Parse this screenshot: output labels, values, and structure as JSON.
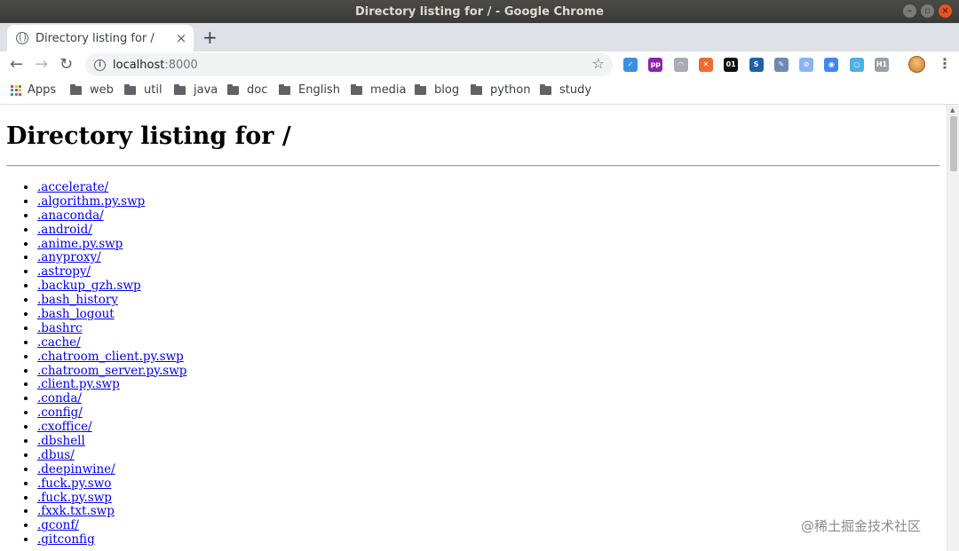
{
  "window": {
    "title": "Directory listing for / - Google Chrome"
  },
  "tab": {
    "title": "Directory listing for /",
    "close_glyph": "×",
    "new_tab_glyph": "+"
  },
  "toolbar": {
    "back_glyph": "←",
    "forward_glyph": "→",
    "reload_glyph": "↻",
    "url_host": "localhost",
    "url_port": ":8000",
    "star_glyph": "☆",
    "menu_glyph": "⋮",
    "extensions": [
      {
        "name": "paperplane-ext-icon",
        "color": "#3d8fe0",
        "text": "✓"
      },
      {
        "name": "purple-ext-icon",
        "color": "#8e24aa",
        "text": "pp"
      },
      {
        "name": "ghost-ext-icon",
        "color": "#a8acb2",
        "text": "◠"
      },
      {
        "name": "orange-ext-icon",
        "color": "#ef6c2e",
        "text": "✕"
      },
      {
        "name": "binary-ext-icon",
        "color": "#111111",
        "text": "01"
      },
      {
        "name": "s-ext-icon",
        "color": "#1e5fa8",
        "text": "S"
      },
      {
        "name": "translate-ext-icon",
        "color": "#6f8ab0",
        "text": "✎"
      },
      {
        "name": "doc-ext-icon",
        "color": "#8ab4f8",
        "text": "⊘"
      },
      {
        "name": "chrome-ext-icon",
        "color": "#4285f4",
        "text": "◉"
      },
      {
        "name": "ring-ext-icon",
        "color": "#4fb0e8",
        "text": "○"
      },
      {
        "name": "h1-ext-icon",
        "color": "#9aa0a6",
        "text": "H1"
      }
    ]
  },
  "bookmarks": {
    "apps_label": "Apps",
    "apps_colors": [
      "#ea4335",
      "#fbbc04",
      "#34a853",
      "#4285f4",
      "#ea4335",
      "#fbbc04",
      "#34a853",
      "#4285f4",
      "#ea4335"
    ],
    "items": [
      "web",
      "util",
      "java",
      "doc",
      "English",
      "media",
      "blog",
      "python",
      "study"
    ]
  },
  "page": {
    "heading": "Directory listing for /",
    "entries": [
      ".accelerate/",
      ".algorithm.py.swp",
      ".anaconda/",
      ".android/",
      ".anime.py.swp",
      ".anyproxy/",
      ".astropy/",
      ".backup_gzh.swp",
      ".bash_history",
      ".bash_logout",
      ".bashrc",
      ".cache/",
      ".chatroom_client.py.swp",
      ".chatroom_server.py.swp",
      ".client.py.swp",
      ".conda/",
      ".config/",
      ".cxoffice/",
      ".dbshell",
      ".dbus/",
      ".deepinwine/",
      ".fuck.py.swo",
      ".fuck.py.swp",
      ".fxxk.txt.swp",
      ".gconf/",
      ".gitconfig"
    ]
  },
  "watermark": "@稀土掘金技术社区"
}
